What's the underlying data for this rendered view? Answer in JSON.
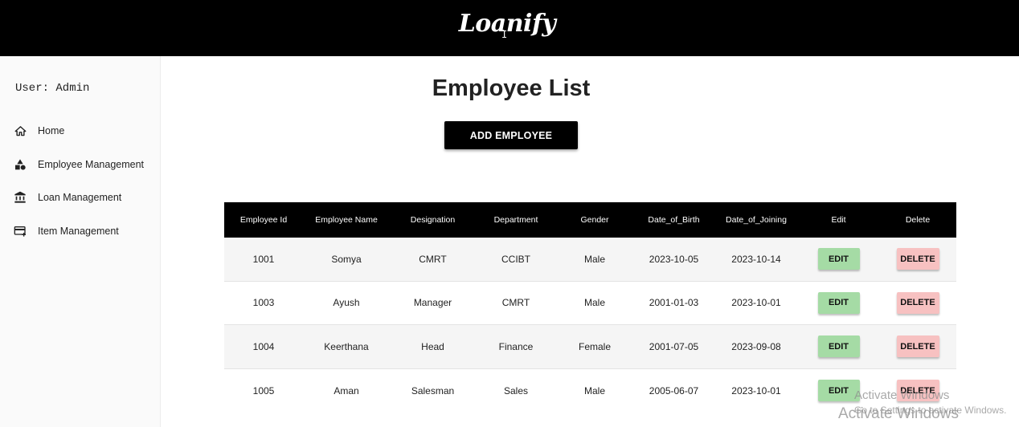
{
  "app": {
    "logo": "Loanify"
  },
  "sidebar": {
    "user_label": "User: Admin",
    "items": [
      {
        "label": "Home",
        "icon": "home-icon"
      },
      {
        "label": "Employee Management",
        "icon": "category-icon"
      },
      {
        "label": "Loan Management",
        "icon": "bank-icon"
      },
      {
        "label": "Item Management",
        "icon": "card-add-icon"
      }
    ]
  },
  "main": {
    "title": "Employee List",
    "add_button": "ADD EMPLOYEE",
    "table": {
      "columns": [
        "Employee Id",
        "Employee Name",
        "Designation",
        "Department",
        "Gender",
        "Date_of_Birth",
        "Date_of_Joining",
        "Edit",
        "Delete"
      ],
      "rows": [
        [
          "1001",
          "Somya",
          "CMRT",
          "CCIBT",
          "Male",
          "2023-10-05",
          "2023-10-14"
        ],
        [
          "1003",
          "Ayush",
          "Manager",
          "CMRT",
          "Male",
          "2001-01-03",
          "2023-10-01"
        ],
        [
          "1004",
          "Keerthana",
          "Head",
          "Finance",
          "Female",
          "2001-07-05",
          "2023-09-08"
        ],
        [
          "1005",
          "Aman",
          "Salesman",
          "Sales",
          "Male",
          "2005-06-07",
          "2023-10-01"
        ]
      ],
      "edit_label": "EDIT",
      "delete_label": "DELETE"
    }
  },
  "watermark": {
    "line1": "Activate Windows",
    "line2": "Go to Settings to activate Windows.",
    "line3": "Activate Windows"
  },
  "colors": {
    "header_bg": "#000000",
    "edit_button": "#a5dba5",
    "delete_button": "#f7c1c1"
  }
}
